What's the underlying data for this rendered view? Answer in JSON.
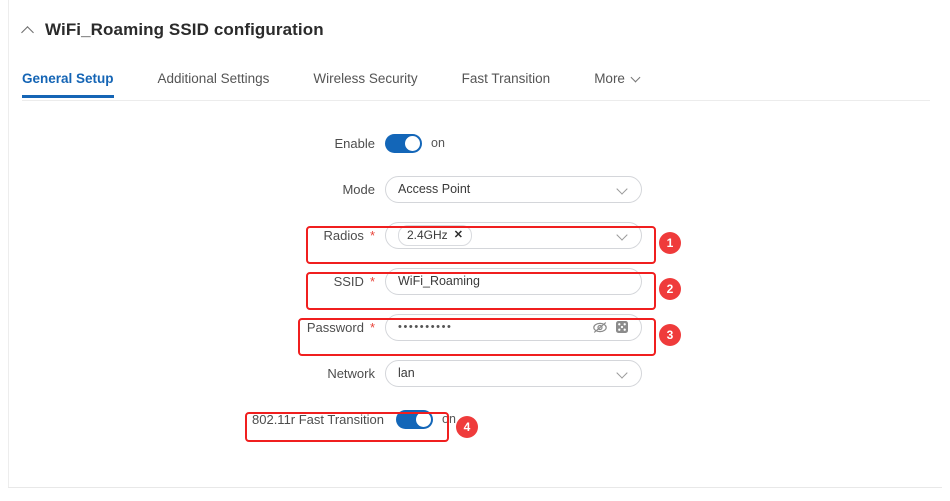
{
  "header": {
    "title": "WiFi_Roaming SSID configuration",
    "collapse_icon": "chevron-up-icon"
  },
  "tabs": [
    {
      "label": "General Setup",
      "active": true
    },
    {
      "label": "Additional Settings",
      "active": false
    },
    {
      "label": "Wireless Security",
      "active": false
    },
    {
      "label": "Fast Transition",
      "active": false
    },
    {
      "label": "More",
      "active": false,
      "chevron": "chevron-down-icon"
    }
  ],
  "form": {
    "enable": {
      "label": "Enable",
      "state": "on",
      "state_label": "on"
    },
    "mode": {
      "label": "Mode",
      "value": "Access Point"
    },
    "radios": {
      "label": "Radios",
      "required": "*",
      "tags": [
        "2.4GHz"
      ],
      "tag_remove_icon": "close-icon"
    },
    "ssid": {
      "label": "SSID",
      "required": "*",
      "value": "WiFi_Roaming"
    },
    "password": {
      "label": "Password",
      "required": "*",
      "value": "••••••••••",
      "reveal_icon": "eye-slash-icon",
      "generate_icon": "dice-icon"
    },
    "network": {
      "label": "Network",
      "value": "lan"
    },
    "fast_transition": {
      "label": "802.11r Fast Transition",
      "state": "on",
      "state_label": "on"
    }
  },
  "annotations": [
    {
      "number": "1",
      "target": "radios"
    },
    {
      "number": "2",
      "target": "ssid"
    },
    {
      "number": "3",
      "target": "password"
    },
    {
      "number": "4",
      "target": "fast_transition"
    }
  ],
  "colors": {
    "accent": "#1565b5",
    "toggle_on": "#1366b8",
    "annotation_red": "#f01f1f",
    "badge_red": "#ef3b3b",
    "required_star": "#e8443a"
  }
}
